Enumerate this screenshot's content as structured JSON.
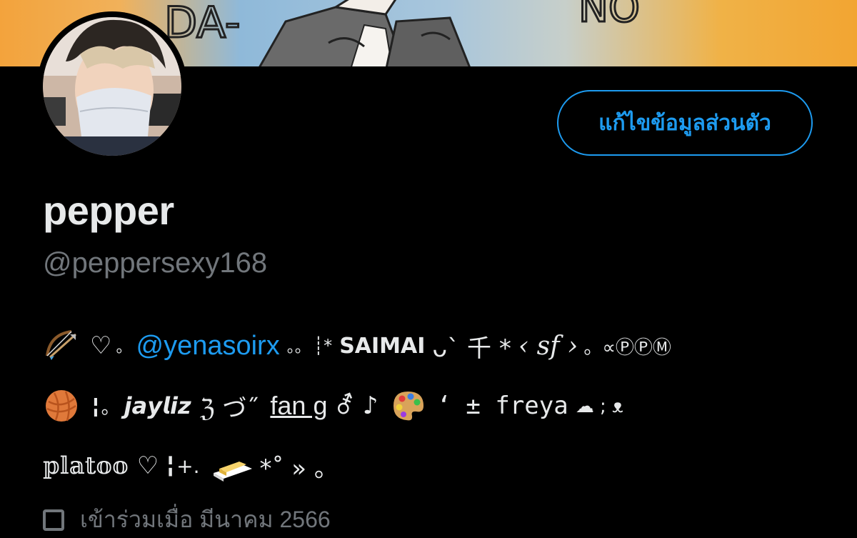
{
  "banner": {
    "art_text_left": "DA-",
    "art_text_right": "NO"
  },
  "profile": {
    "display_name": "pepper",
    "handle": "@peppersexy168"
  },
  "actions": {
    "edit_profile_label": "แก้ไขข้อมูลส่วนตัว"
  },
  "bio": {
    "line1": {
      "bow_emoji": "🏹",
      "heart": "♡",
      "dot1": "。",
      "mention": "@yenasoirx",
      "dots2": "。。",
      "deco_star": "┊*",
      "saimai": "SAIMAI",
      "face": "ᴗ` 千 *",
      "sf": "‹ 𝑠𝑓 ›",
      "tail": "。∝ⓅⓅⓂ"
    },
    "line2": {
      "yarn_emoji": "🧶",
      "prefix": "╏。",
      "jayliz": "𝙟𝙖𝙮𝙡𝙞𝙯",
      "jp": "ℨ づ˝",
      "fang": "fan g",
      "gender_note": "⚦ ♪",
      "palette_emoji": "🎨",
      "freya": "‘ ± 𝚏𝚛𝚎𝚢𝚊",
      "tail": "☁︎ ; ᴥ"
    },
    "line3": {
      "platoo": "𝕡𝕝𝕒𝕥𝕠𝕠",
      "heart": "♡",
      "mid": "╏+.",
      "butter_emoji": "🧈",
      "tail": "*˚ » 。"
    }
  },
  "meta": {
    "joined_text": "เข้าร่วมเมื่อ มีนาคม 2566"
  },
  "colors": {
    "accent": "#1d9bf0",
    "background": "#000000",
    "secondary_text": "#71767b",
    "primary_text": "#e7e9ea"
  }
}
